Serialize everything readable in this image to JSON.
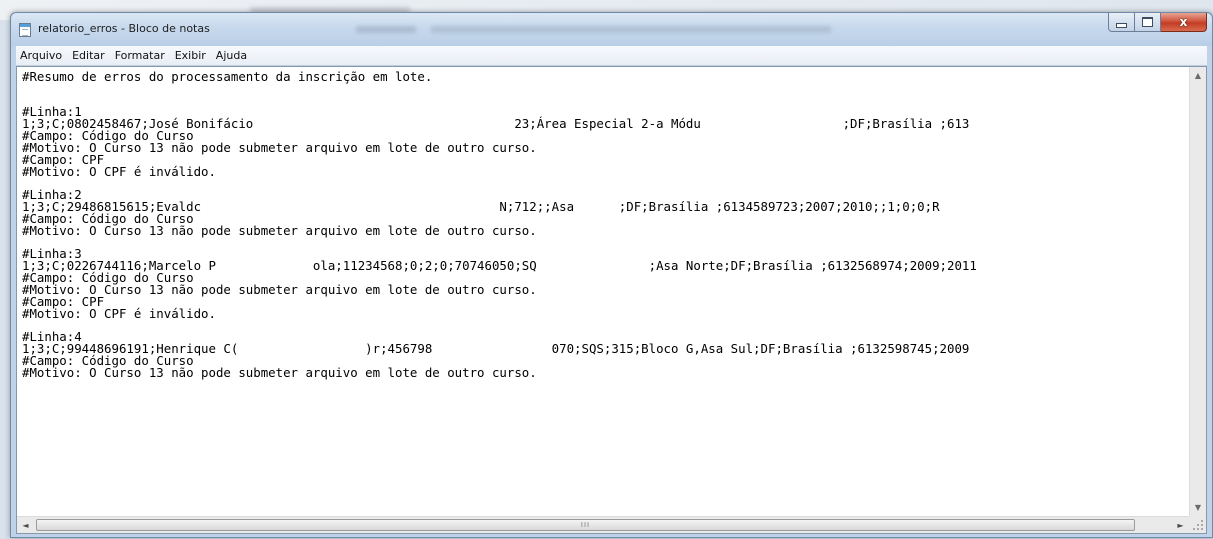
{
  "window": {
    "title": "relatorio_erros - Bloco de notas",
    "close_glyph": "x"
  },
  "menu": {
    "items": [
      "Arquivo",
      "Editar",
      "Formatar",
      "Exibir",
      "Ajuda"
    ]
  },
  "document": {
    "header": "#Resumo de erros do processamento da inscrição em lote.",
    "records": [
      {
        "heading": "#Linha:1",
        "data": "1;3;C;0802458467;José Bonifácio                                   23;Área Especial 2-a Módu                   ;DF;Brasília ;613",
        "details": [
          "#Campo: Código do Curso",
          "#Motivo: O Curso 13 não pode submeter arquivo em lote de outro curso.",
          "#Campo: CPF",
          "#Motivo: O CPF é inválido."
        ]
      },
      {
        "heading": "#Linha:2",
        "data": "1;3;C;29486815615;Evaldc                                        N;712;;Asa      ;DF;Brasília ;6134589723;2007;2010;;1;0;0;R",
        "details": [
          "#Campo: Código do Curso",
          "#Motivo: O Curso 13 não pode submeter arquivo em lote de outro curso."
        ]
      },
      {
        "heading": "#Linha:3",
        "data": "1;3;C;0226744116;Marcelo P             ola;11234568;0;2;0;70746050;SQ               ;Asa Norte;DF;Brasília ;6132568974;2009;2011",
        "details": [
          "#Campo: Código do Curso",
          "#Motivo: O Curso 13 não pode submeter arquivo em lote de outro curso.",
          "#Campo: CPF",
          "#Motivo: O CPF é inválido."
        ]
      },
      {
        "heading": "#Linha:4",
        "data": "1;3;C;99448696191;Henrique C(                 )r;456798                070;SQS;315;Bloco G,Asa Sul;DF;Brasília ;6132598745;2009",
        "details": [
          "#Campo: Código do Curso",
          "#Motivo: O Curso 13 não pode submeter arquivo em lote de outro curso."
        ]
      }
    ]
  },
  "scrollbars": {
    "up_arrow": "▲",
    "down_arrow": "▼",
    "left_arrow": "◄",
    "right_arrow": "►",
    "grip": "III"
  },
  "colors": {
    "titlebar": "#c7d9ed",
    "close_button": "#c23c23",
    "editor_background": "#ffffff"
  }
}
